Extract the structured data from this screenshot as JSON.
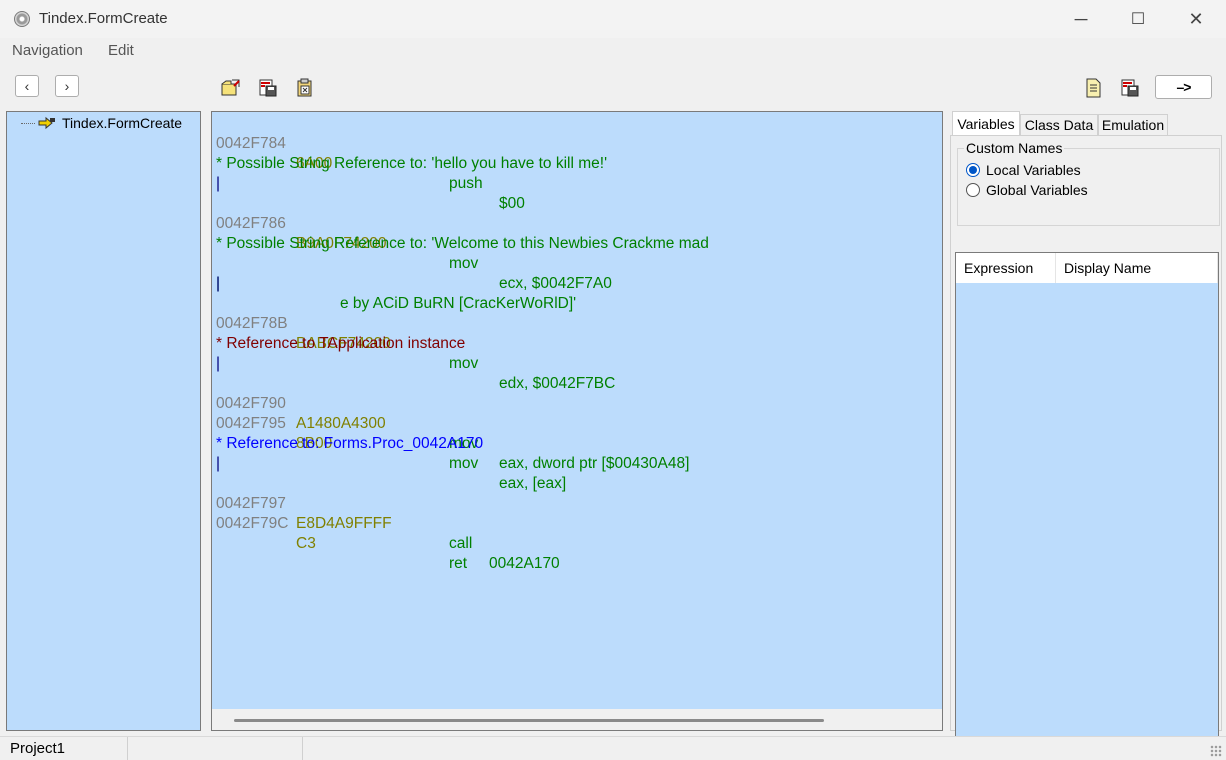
{
  "window": {
    "title": "Tindex.FormCreate",
    "minimize_glyph": "─",
    "maximize_glyph": "☐",
    "close_glyph": "✕"
  },
  "menu": [
    "Navigation",
    "Edit"
  ],
  "toolbar": {
    "back": "‹",
    "forward": "›",
    "goto_label": "–>",
    "icons": [
      "open-folder-icon",
      "save-disk-icon",
      "copy-clipboard-icon",
      "document-icon",
      "save-document-icon"
    ]
  },
  "tree": {
    "root_label": "Tindex.FormCreate"
  },
  "code": {
    "line1": {
      "addr": "0042F784",
      "hex": "6A00",
      "mnem": "push",
      "oper": "$00"
    },
    "ref1": "* Possible String Reference to: 'hello you have to kill me!'",
    "bar1": "|",
    "line2": {
      "addr": "0042F786",
      "hex": "B9A0F74200",
      "mnem": "mov",
      "oper": "ecx, $0042F7A0"
    },
    "ref2a": "* Possible String Reference to: 'Welcome to this Newbies Crackme mad",
    "ref2b_bar": "|",
    "ref2b_text": "e by ACiD BuRN [CracKerWoRlD]'",
    "bar2": "|",
    "line3": {
      "addr": "0042F78B",
      "hex": "BABCF74200",
      "mnem": "mov",
      "oper": "edx, $0042F7BC"
    },
    "ref3": "* Reference to TApplication instance",
    "bar3": "|",
    "line4": {
      "addr": "0042F790",
      "hex": "A1480A4300",
      "mnem": "mov",
      "oper": "eax, dword ptr [$00430A48]"
    },
    "line5": {
      "addr": "0042F795",
      "hex": "8B00",
      "mnem": "mov",
      "oper": "eax, [eax]"
    },
    "ref4": "* Reference to: Forms.Proc_0042A170",
    "bar4": "|",
    "line6": {
      "addr": "0042F797",
      "hex": "E8D4A9FFFF",
      "mnem": "call",
      "oper": "0042A170"
    },
    "line7": {
      "addr": "0042F79C",
      "hex": "C3",
      "mnem": "ret",
      "oper": ""
    }
  },
  "right_panel": {
    "tabs": [
      "Variables",
      "Class Data",
      "Emulation"
    ],
    "active_tab": "Variables",
    "group_title": "Custom Names",
    "radio_local": "Local Variables",
    "radio_global": "Global Variables",
    "selected_radio": "Local Variables",
    "columns": [
      "Expression",
      "Display Name"
    ]
  },
  "status": {
    "project": "Project1"
  },
  "colors": {
    "panel_bg": "#bcdcfc",
    "address": "#808080",
    "hex": "#808000",
    "instruction": "#008000",
    "string_ref": "#008000",
    "app_ref": "#800000",
    "proc_ref": "#0000ff"
  }
}
